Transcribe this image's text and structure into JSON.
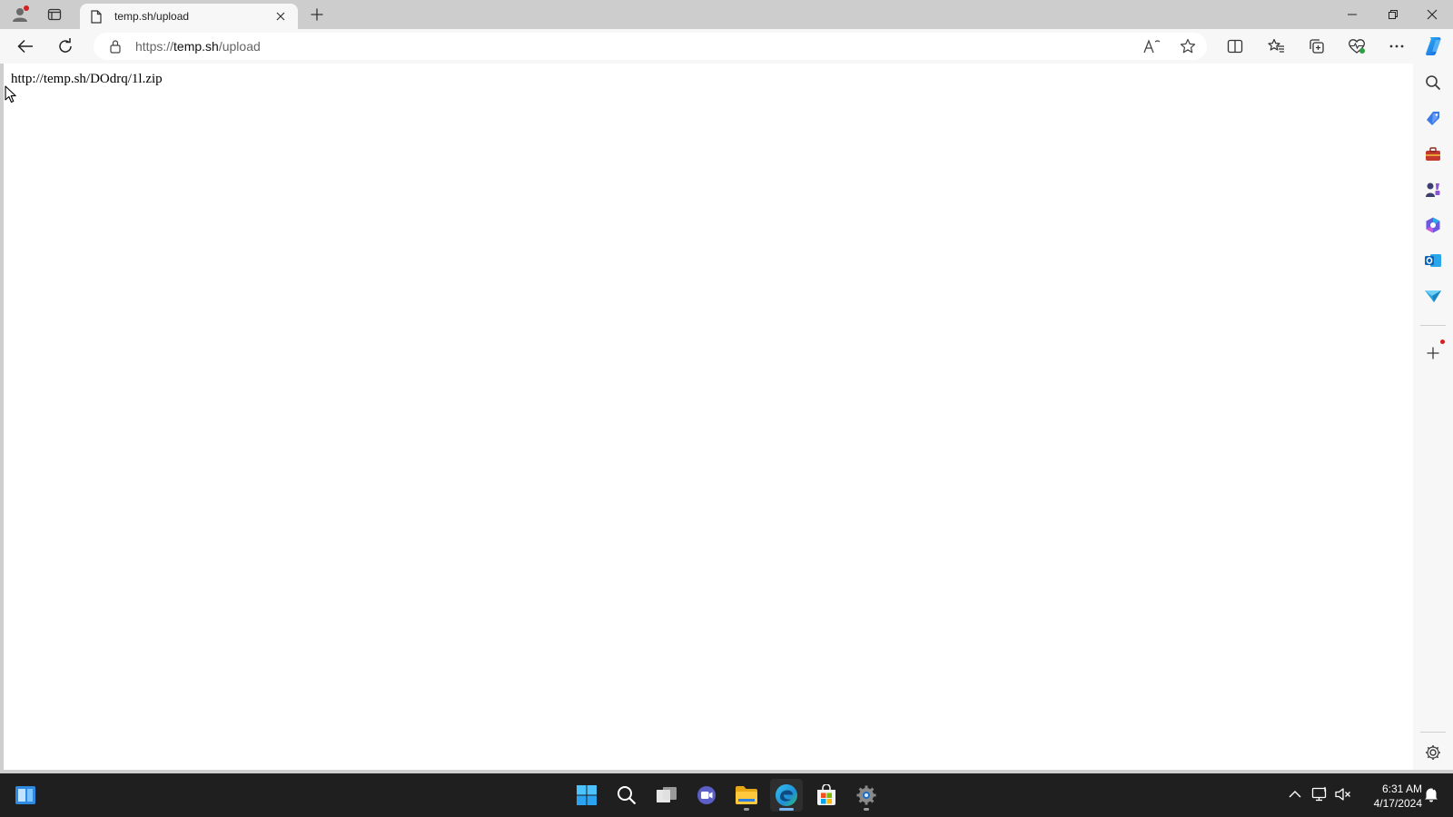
{
  "browser": {
    "tab": {
      "title": "temp.sh/upload"
    },
    "address": {
      "scheme": "https://",
      "host": "temp.sh",
      "path": "/upload"
    }
  },
  "page": {
    "text": "http://temp.sh/DOdrq/1l.zip"
  },
  "icons": {
    "profile": "profile-icon",
    "tab_actions": "tab-actions-icon",
    "page": "page-icon",
    "back": "back-arrow-icon",
    "refresh": "refresh-icon",
    "lock": "lock-icon",
    "read_aloud": "read-aloud-icon",
    "favorite": "star-icon",
    "split_screen": "split-screen-icon",
    "favorites": "favorites-icon",
    "collections": "collections-icon",
    "browser_essentials": "heart-pulse-icon",
    "more": "more-icon",
    "copilot": "copilot-icon"
  },
  "sidebar": [
    {
      "name": "search-icon"
    },
    {
      "name": "shopping-tag-icon"
    },
    {
      "name": "tools-icon"
    },
    {
      "name": "games-icon"
    },
    {
      "name": "microsoft365-icon"
    },
    {
      "name": "outlook-icon"
    },
    {
      "name": "send-icon"
    }
  ],
  "taskbar": {
    "apps": [
      "start",
      "search",
      "task-view",
      "meet",
      "file-explorer",
      "edge",
      "store",
      "settings"
    ]
  },
  "system_tray": {
    "time": "6:31 AM",
    "date": "4/17/2024"
  },
  "colors": {
    "notification_dot": "#d32020",
    "copilot": "#1a73e8",
    "taskbar_bg": "#1f1f1f"
  }
}
